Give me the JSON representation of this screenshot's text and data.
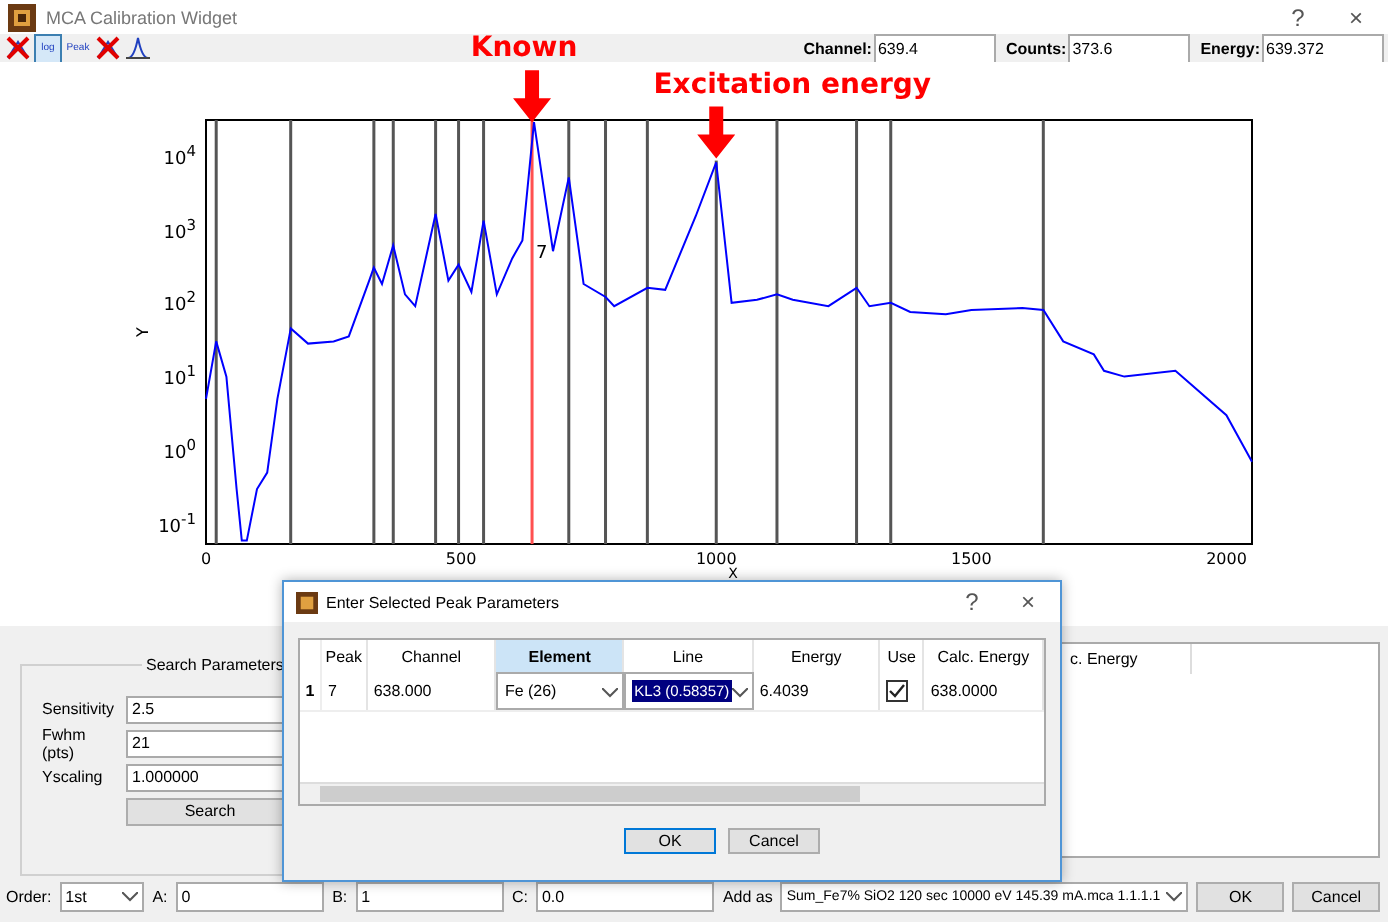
{
  "window": {
    "title": "MCA Calibration Widget",
    "help": "?",
    "close": "×"
  },
  "toolbar": [
    {
      "kind": "clear",
      "selected": false
    },
    {
      "kind": "log",
      "label": "log",
      "selected": true
    },
    {
      "kind": "peak",
      "label": "Peak",
      "selected": false
    },
    {
      "kind": "clear",
      "selected": false
    },
    {
      "kind": "fit",
      "selected": false
    }
  ],
  "readouts": [
    {
      "label": "Channel:",
      "value": "639.4"
    },
    {
      "label": "Counts:",
      "value": "373.6"
    },
    {
      "label": "Energy:",
      "value": "639.372"
    }
  ],
  "plot": {
    "xlabel": "X",
    "ylabel": "Y",
    "xticks": [
      "0",
      "500",
      "1000",
      "1500",
      "2000"
    ],
    "yticks": [
      "10$^{4}$",
      "10$^{3}$",
      "10$^{2}$",
      "10$^{1}$",
      "10$^{0}$",
      "10$^{-1}$"
    ],
    "peak_lines": [
      {
        "selected": false
      },
      {
        "selected": false
      },
      {
        "selected": false
      },
      {
        "selected": false
      },
      {
        "selected": false
      },
      {
        "selected": false
      },
      {
        "selected": false
      },
      {
        "selected": true,
        "label": "7"
      },
      {
        "selected": false
      },
      {
        "selected": false
      },
      {
        "selected": false
      },
      {
        "selected": false
      },
      {
        "selected": false
      },
      {
        "selected": false
      },
      {
        "selected": false
      },
      {
        "selected": false
      }
    ],
    "callouts": [
      {
        "text": "Known"
      },
      {
        "text": "Excitation energy"
      }
    ]
  },
  "search": {
    "title": "Search Parameters",
    "fields": [
      {
        "label": "Sensitivity",
        "value": "2.5"
      },
      {
        "label": "Fwhm (pts)",
        "value": "21"
      },
      {
        "label": "Yscaling",
        "value": "1.000000"
      }
    ],
    "button": "Search"
  },
  "right_list": {
    "header": "c. Energy"
  },
  "bottom": {
    "order_label": "Order:",
    "order": "1st",
    "a_label": "A:",
    "a": "0",
    "b_label": "B:",
    "b": "1",
    "c_label": "C:",
    "c": "0.0",
    "add_label": "Add as",
    "add": "Sum_Fe7% SiO2  120 sec 10000 eV 145.39 mA.mca 1.1.1.1",
    "ok": "OK",
    "cancel": "Cancel"
  },
  "dialog": {
    "title": "Enter Selected Peak Parameters",
    "help": "?",
    "close": "×",
    "columns": [
      {
        "label": "Peak",
        "selected": false
      },
      {
        "label": "Channel",
        "selected": false
      },
      {
        "label": "Element",
        "selected": true
      },
      {
        "label": "Line",
        "selected": false
      },
      {
        "label": "Energy",
        "selected": false
      },
      {
        "label": "Use",
        "selected": false
      },
      {
        "label": "Calc. Energy",
        "selected": false
      }
    ],
    "rows": [
      {
        "index": "1",
        "peak": "7",
        "channel": "638.000",
        "element": "Fe (26)",
        "line": "KL3 (0.58357)",
        "energy": "6.4039",
        "use": true,
        "calc": "638.0000"
      }
    ],
    "ok": "OK",
    "cancel": "Cancel"
  }
}
